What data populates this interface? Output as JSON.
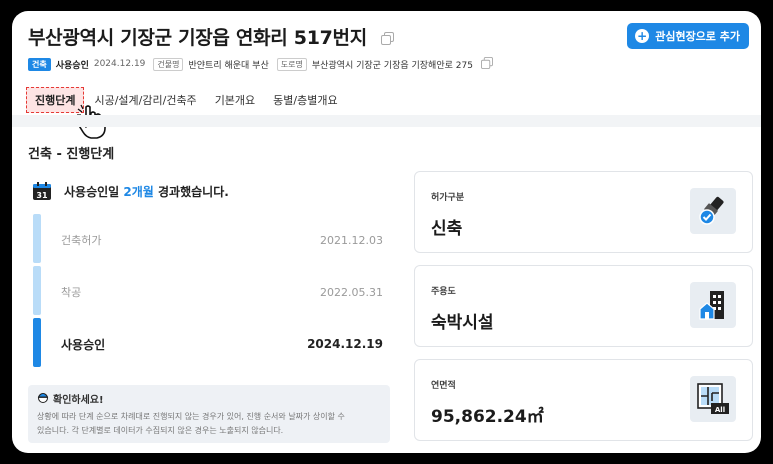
{
  "header": {
    "title": "부산광역시 기장군 기장읍 연화리 517번지",
    "add_button_label": "관심현장으로 추가"
  },
  "meta": {
    "type_badge": "건축",
    "status": "사용승인",
    "date": "2024.12.19",
    "building_label": "건물명",
    "building_name": "반얀트리 해운대 부산",
    "road_label": "도로명",
    "road_address": "부산광역시 기장군 기장읍 기장해안로 275"
  },
  "tabs": [
    {
      "label": "진행단계",
      "active": true
    },
    {
      "label": "시공/설계/감리/건축주"
    },
    {
      "label": "기본개요"
    },
    {
      "label": "동별/층별개요"
    }
  ],
  "section_title": "건축 - 진행단계",
  "calendar_day": "31",
  "progress": {
    "prefix": "사용승인일 ",
    "elapsed": "2개월",
    "suffix": " 경과했습니다."
  },
  "steps": [
    {
      "name": "건축허가",
      "date": "2021.12.03"
    },
    {
      "name": "착공",
      "date": "2022.05.31"
    },
    {
      "name": "사용승인",
      "date": "2024.12.19"
    }
  ],
  "notice": {
    "title": "확인하세요!",
    "line1": "상황에 따라 단계 순으로 차례대로 진행되지 않는 경우가 있어, 진행 순서와 날짜가 상이할 수",
    "line2": "있습니다. 각 단계별로 데이터가 수집되지 않은 경우는 노출되지 않습니다."
  },
  "cards": [
    {
      "label": "허가구분",
      "value": "신축",
      "icon": "brush-check-icon"
    },
    {
      "label": "주용도",
      "value": "숙박시설",
      "icon": "building-icon"
    },
    {
      "label": "연면적",
      "value": "95,862.24㎡",
      "icon": "floorplan-icon"
    }
  ],
  "colors": {
    "accent": "#1e88e5",
    "accent_light": "#b9dcf8",
    "active_tab_border": "#e53935"
  }
}
